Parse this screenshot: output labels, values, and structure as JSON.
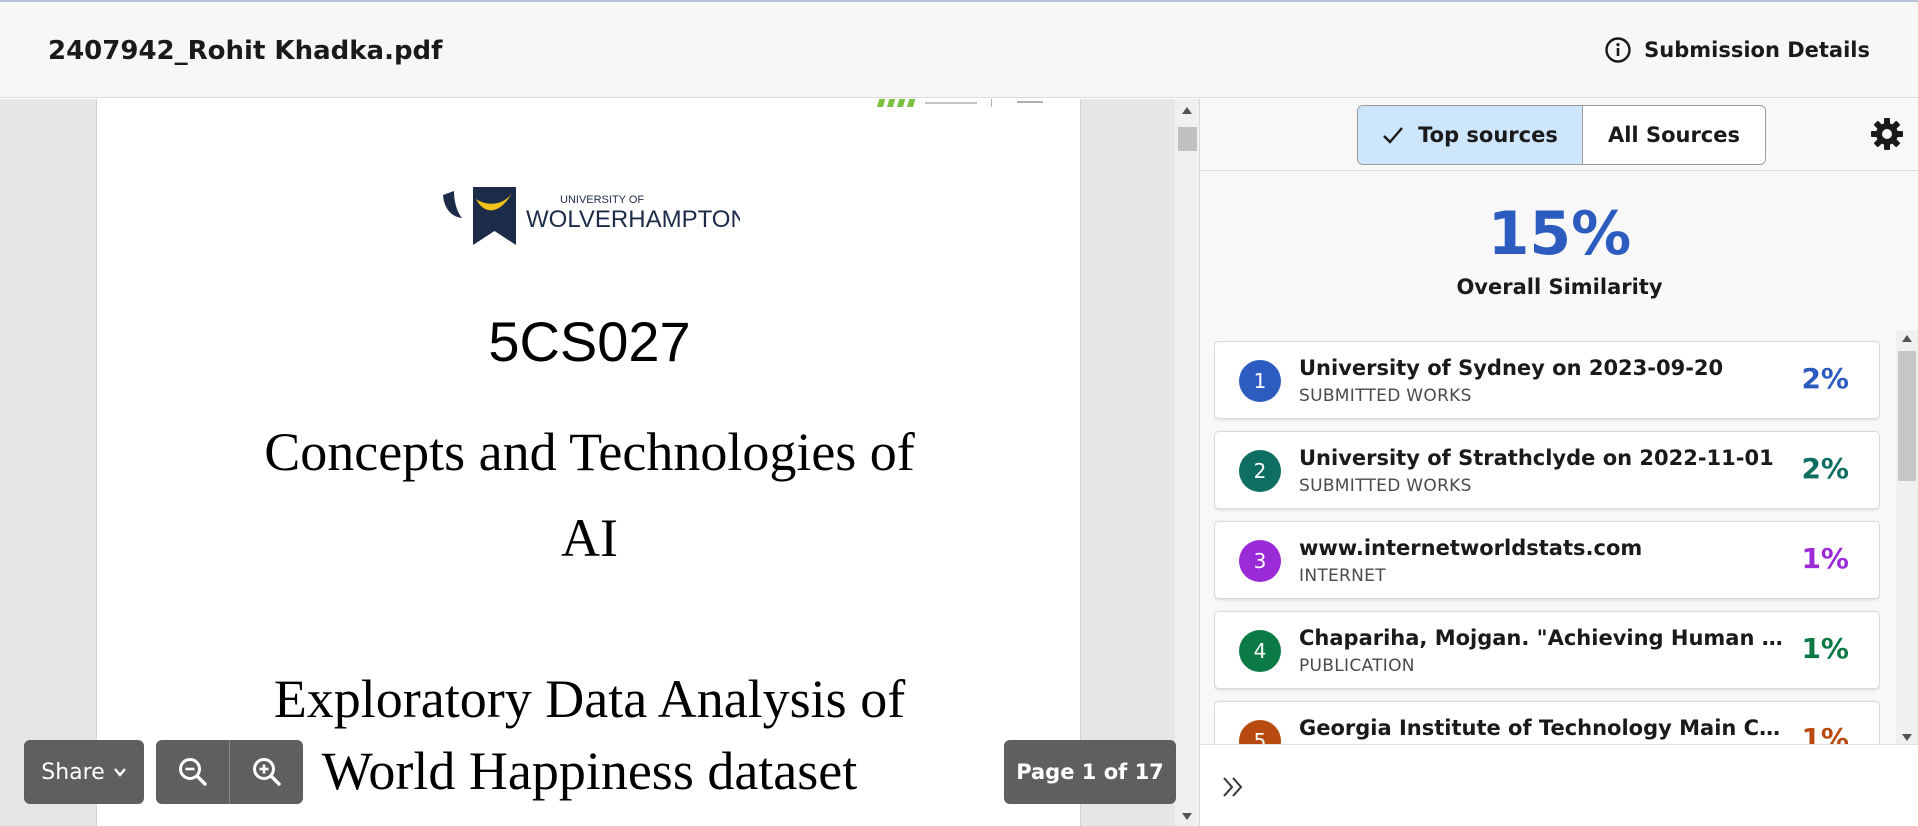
{
  "header": {
    "file_name": "2407942_Rohit Khadka.pdf",
    "submission_details_label": "Submission Details"
  },
  "document": {
    "logo_line1": "UNIVERSITY OF",
    "logo_line2": "WOLVERHAMPTON",
    "module_code": "5CS027",
    "module_title_line1": "Concepts and Technologies of",
    "module_title_line2": "AI",
    "report_title_line1": "Exploratory Data Analysis of",
    "report_title_line2": "World Happiness dataset"
  },
  "controls": {
    "share_label": "Share",
    "page_indicator": "Page 1 of 17"
  },
  "panel": {
    "tabs": [
      {
        "label": "Top sources",
        "active": true
      },
      {
        "label": "All Sources",
        "active": false
      }
    ],
    "overall_score": "15%",
    "overall_label": "Overall Similarity",
    "sources": [
      {
        "num": "1",
        "title": "University of Sydney on 2023-09-20",
        "type": "SUBMITTED WORKS",
        "percent": "2%",
        "color": "#2d5cc0"
      },
      {
        "num": "2",
        "title": "University of Strathclyde on 2022-11-01",
        "type": "SUBMITTED WORKS",
        "percent": "2%",
        "color": "#0f6e63"
      },
      {
        "num": "3",
        "title": "www.internetworldstats.com",
        "type": "INTERNET",
        "percent": "1%",
        "color": "#9b2bd6"
      },
      {
        "num": "4",
        "title": "Chapariha, Mojgan. \"Achieving Human and Ec...",
        "type": "PUBLICATION",
        "percent": "1%",
        "color": "#0c7a45"
      },
      {
        "num": "5",
        "title": "Georgia Institute of Technology Main Campus...",
        "type": "",
        "percent": "1%",
        "color": "#b84a10"
      }
    ]
  },
  "colors": {
    "accent": "#2d5cc0",
    "active_tab_bg": "#cde6fb",
    "control_bg": "#5f5f5f",
    "logo_navy": "#1c2b48",
    "logo_gold": "#f0c419",
    "college_green": "#7cc242"
  },
  "icons": {
    "info": "info-circle-icon",
    "check": "check-icon",
    "settings": "gear-icon",
    "share_dropdown": "chevron-down-icon",
    "zoom_out": "zoom-out-icon",
    "zoom_in": "zoom-in-icon",
    "expand_panel": "double-chevron-right-icon"
  }
}
